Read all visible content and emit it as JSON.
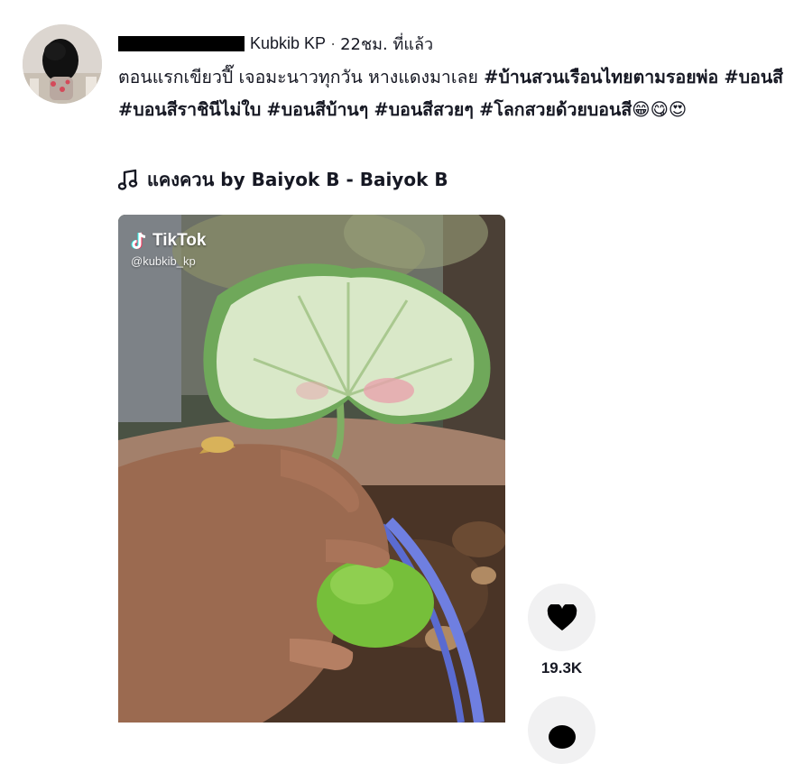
{
  "post": {
    "author": "Kubkib KP",
    "separator": "·",
    "time": "22ชม. ที่แล้ว",
    "caption_text": "ตอนแรกเขียวปี๊ เจอมะนาวทุกวัน หางแดงมาเลย ",
    "hashtags": [
      "#บ้านสวนเรือนไทยตามรอยพ่อ",
      "#บอนสี",
      "#บอนสีราชินีไม่ใบ",
      "#บอนสีบ้านๆ",
      "#บอนสีสวยๆ",
      "#โลกสวยด้วยบอนสี"
    ],
    "emojis": "😁😋😍",
    "music_title": "แคงควน by Baiyok B - Baiyok B",
    "music_icon": "music-note-icon"
  },
  "video": {
    "watermark_brand": "TikTok",
    "watermark_handle": "@kubkib_kp"
  },
  "actions": {
    "like_icon": "heart-icon",
    "like_count": "19.3K",
    "comment_icon": "comment-icon"
  }
}
